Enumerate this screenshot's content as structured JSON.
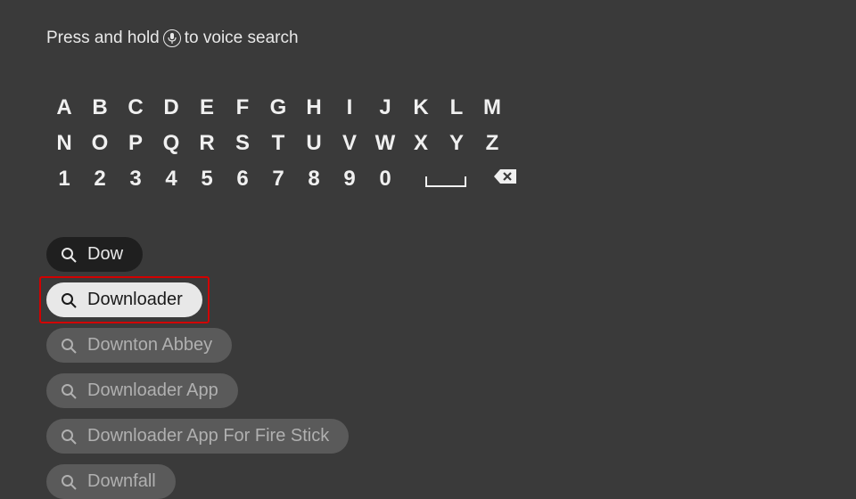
{
  "hint": {
    "prefix": "Press and hold",
    "suffix": "to voice search"
  },
  "keyboard": {
    "row1": [
      "A",
      "B",
      "C",
      "D",
      "E",
      "F",
      "G",
      "H",
      "I",
      "J",
      "K",
      "L",
      "M"
    ],
    "row2": [
      "N",
      "O",
      "P",
      "Q",
      "R",
      "S",
      "T",
      "U",
      "V",
      "W",
      "X",
      "Y",
      "Z"
    ],
    "row3": [
      "1",
      "2",
      "3",
      "4",
      "5",
      "6",
      "7",
      "8",
      "9",
      "0"
    ]
  },
  "suggestions": [
    {
      "label": "Dow",
      "style": "dark",
      "highlighted": false
    },
    {
      "label": "Downloader",
      "style": "selected",
      "highlighted": true
    },
    {
      "label": "Downton Abbey",
      "style": "grey",
      "highlighted": false
    },
    {
      "label": "Downloader App",
      "style": "grey",
      "highlighted": false
    },
    {
      "label": "Downloader App For Fire Stick",
      "style": "grey",
      "highlighted": false
    },
    {
      "label": "Downfall",
      "style": "grey",
      "highlighted": false
    }
  ]
}
